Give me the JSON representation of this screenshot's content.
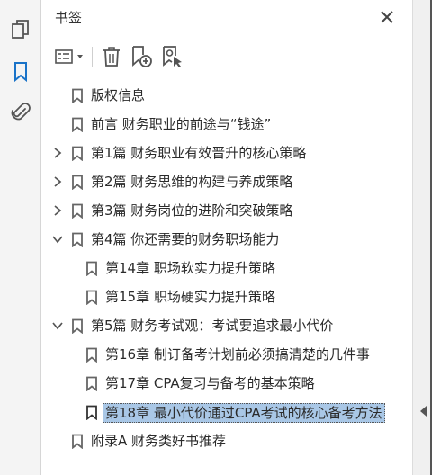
{
  "rail": {
    "icons": [
      "pages-icon",
      "bookmark-icon",
      "attachment-icon"
    ]
  },
  "panel": {
    "title": "书签",
    "close_icon": "close-icon"
  },
  "toolbar": {
    "items": [
      "options-menu-icon",
      "delete-icon",
      "new-bookmark-icon",
      "bookmark-from-selection-icon"
    ]
  },
  "bookmarks": [
    {
      "label": "版权信息",
      "level": 0,
      "expander": "none"
    },
    {
      "label": "前言 财务职业的前途与“钱途”",
      "level": 0,
      "expander": "none"
    },
    {
      "label": "第1篇 财务职业有效晋升的核心策略",
      "level": 0,
      "expander": "collapsed"
    },
    {
      "label": "第2篇 财务思维的构建与养成策略",
      "level": 0,
      "expander": "collapsed"
    },
    {
      "label": "第3篇 财务岗位的进阶和突破策略",
      "level": 0,
      "expander": "collapsed"
    },
    {
      "label": "第4篇 你还需要的财务职场能力",
      "level": 0,
      "expander": "expanded"
    },
    {
      "label": "第14章 职场软实力提升策略",
      "level": 1,
      "expander": "none"
    },
    {
      "label": "第15章 职场硬实力提升策略",
      "level": 1,
      "expander": "none"
    },
    {
      "label": "第5篇 财务考试观：考试要追求最小代价",
      "level": 0,
      "expander": "expanded"
    },
    {
      "label": "第16章 制订备考计划前必须搞清楚的几件事",
      "level": 1,
      "expander": "none"
    },
    {
      "label": "第17章 CPA复习与备考的基本策略",
      "level": 1,
      "expander": "none"
    },
    {
      "label": "第18章 最小代价通过CPA考试的核心备考方法",
      "level": 1,
      "expander": "none",
      "selected": true
    },
    {
      "label": "附录A 财务类好书推荐",
      "level": 0,
      "expander": "none"
    }
  ],
  "colors": {
    "accent": "#1a73c8",
    "selection": "#a9c7e6"
  }
}
